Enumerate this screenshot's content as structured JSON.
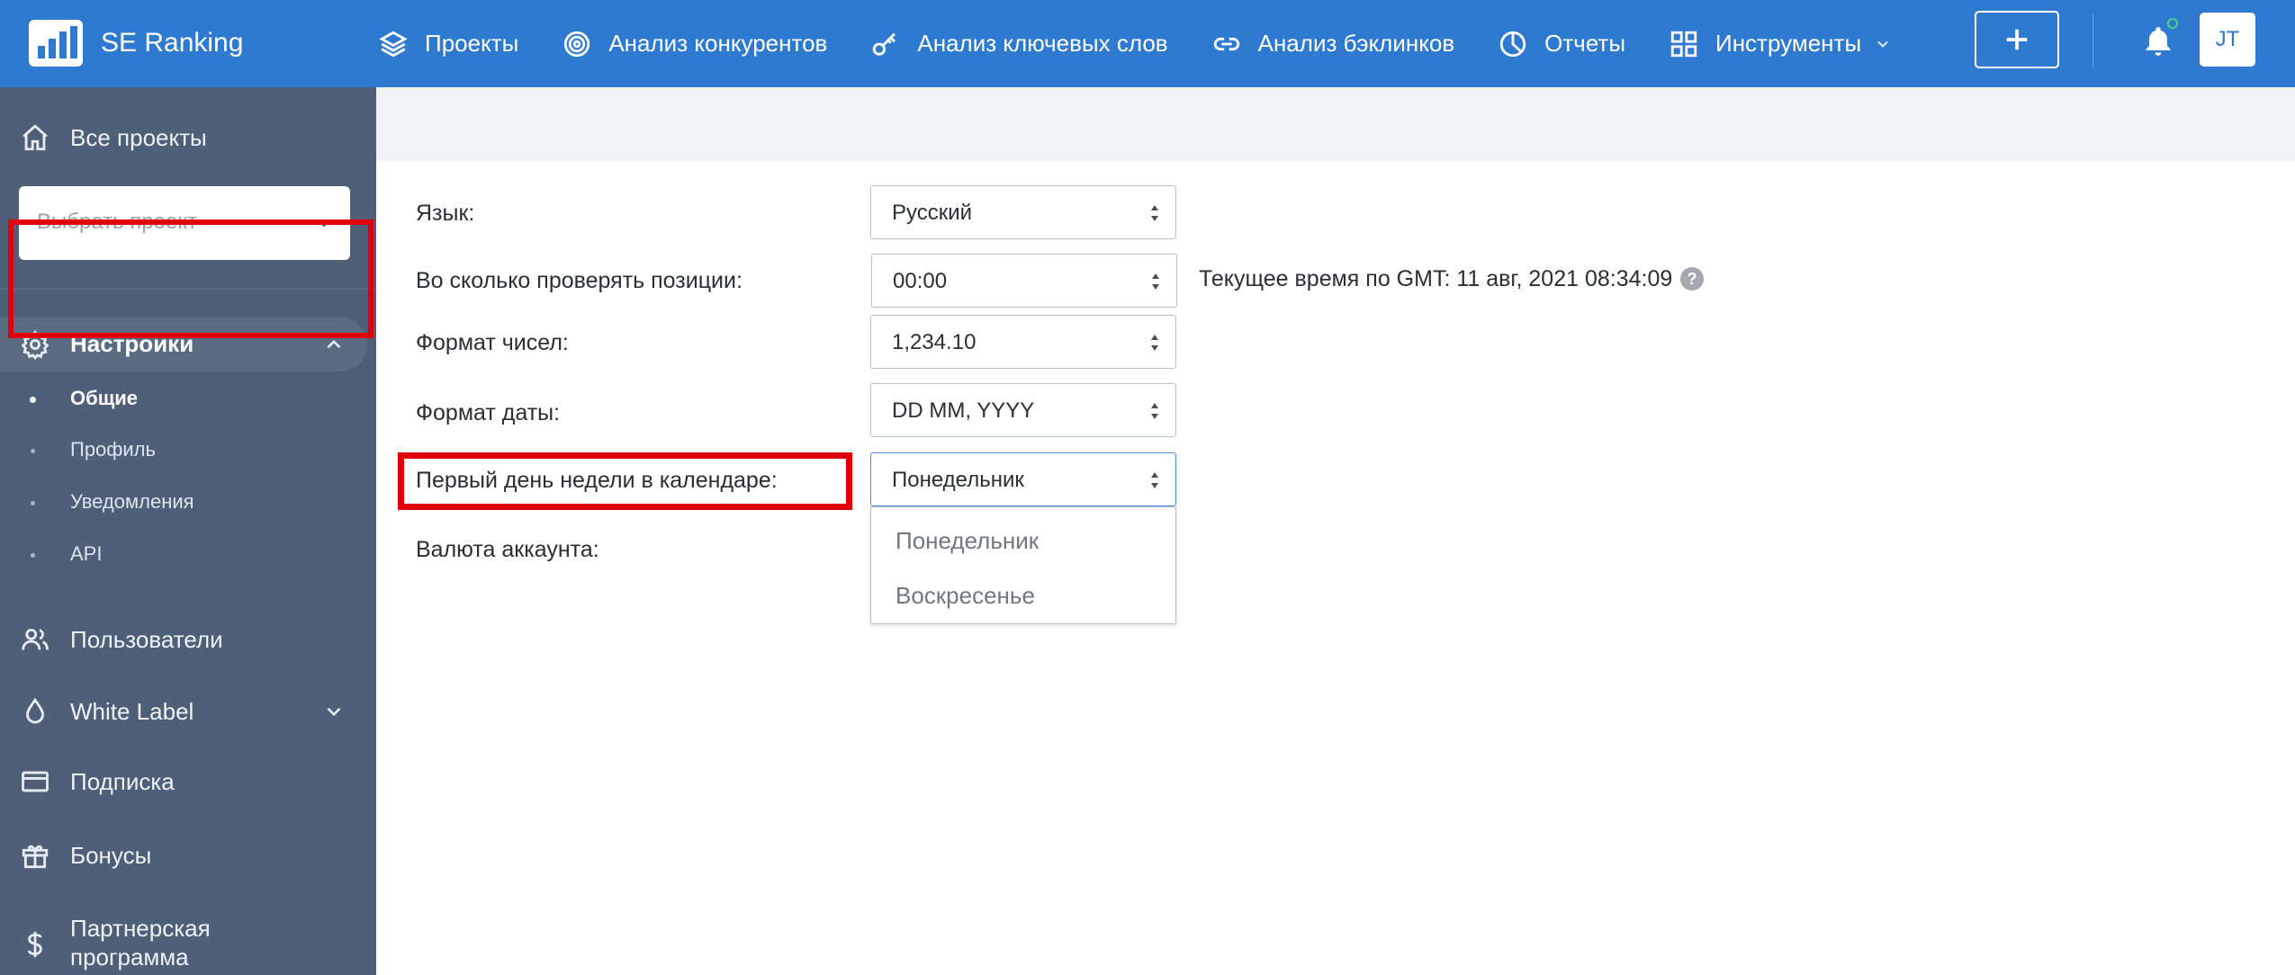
{
  "app": {
    "brand": "SE Ranking"
  },
  "topnav": {
    "items": [
      {
        "label": "Проекты",
        "icon": "layers-icon"
      },
      {
        "label": "Анализ конкурентов",
        "icon": "target-icon"
      },
      {
        "label": "Анализ ключевых слов",
        "icon": "key-icon"
      },
      {
        "label": "Анализ бэклинков",
        "icon": "link-icon"
      },
      {
        "label": "Отчеты",
        "icon": "pie-chart-icon"
      },
      {
        "label": "Инструменты",
        "icon": "grid-icon"
      }
    ],
    "avatar": "JT"
  },
  "sidebar": {
    "all_projects": "Все проекты",
    "project_select_placeholder": "Выбрать проект",
    "settings": "Настройки",
    "settings_items": [
      "Общие",
      "Профиль",
      "Уведомления",
      "API"
    ],
    "users": "Пользователи",
    "white_label": "White Label",
    "subscription": "Подписка",
    "bonuses": "Бонусы",
    "partner_line1": "Партнерская",
    "partner_line2": "программа"
  },
  "form": {
    "language_label": "Язык:",
    "language_value": "Русский",
    "check_time_label": "Во сколько проверять позиции:",
    "check_time_value": "00:00",
    "gmt_text": "Текущее время по GMT: 11 авг, 2021 08:34:09",
    "number_format_label": "Формат чисел:",
    "number_format_value": "1,234.10",
    "date_format_label": "Формат даты:",
    "date_format_value": "DD MM, YYYY",
    "first_day_label": "Первый день недели в календаре:",
    "first_day_value": "Понедельник",
    "first_day_options": [
      "Понедельник",
      "Воскресенье"
    ],
    "currency_label": "Валюта аккаунта:"
  },
  "colors": {
    "topbar": "#2f7ad1",
    "sidebar": "#4e5f77",
    "highlight": "#e0000d",
    "notification_dot": "#4bd18a"
  }
}
